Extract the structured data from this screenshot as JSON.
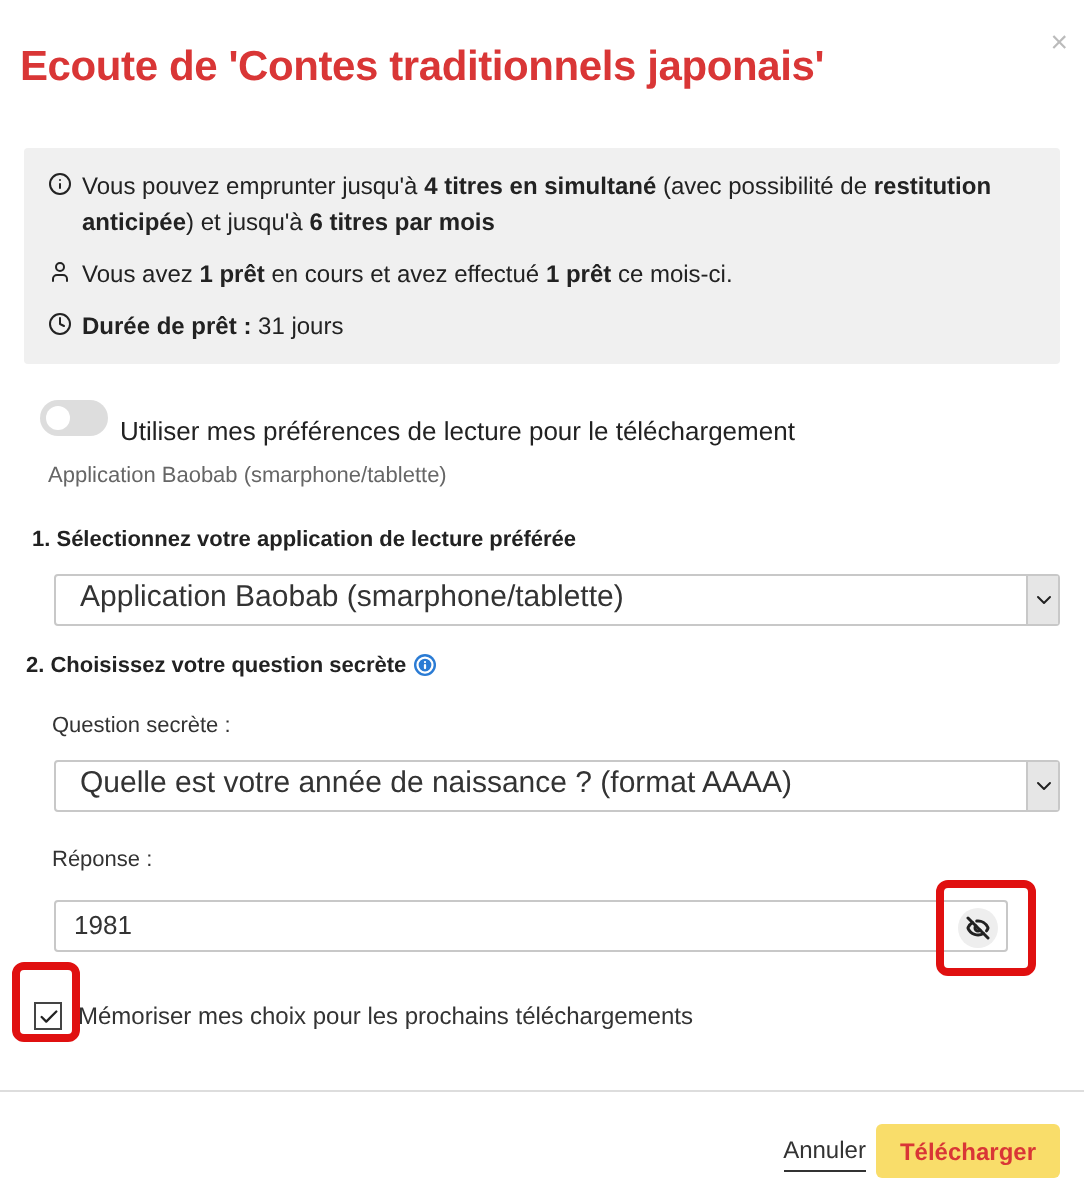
{
  "dialog": {
    "title": "Ecoute de 'Contes traditionnels japonais'",
    "close": "×"
  },
  "info": [
    {
      "kind": "info",
      "text": "Vous pouvez emprunter jusqu'à **4 titres en simultané** (avec possibilité de **restitution anticipée**) et jusqu'à **6 titres par mois**"
    },
    {
      "kind": "user",
      "text": "Vous avez **1 prêt** en cours et avez effectué **1 prêt** ce mois-ci."
    },
    {
      "kind": "clock",
      "text": "**Durée de prêt :** 31 jours"
    }
  ],
  "preferences_toggle": {
    "label": "Utiliser mes préférences de lecture pour le téléchargement",
    "on": false,
    "hint": "Application Baobab (smarphone/tablette)"
  },
  "step_1": {
    "heading": "1. Sélectionnez votre application de lecture préférée",
    "select_value": "Application Baobab (smarphone/tablette)"
  },
  "step_2": {
    "heading": "2. Choisissez votre question secrète",
    "question_label": "Question secrète :",
    "question_value": "Quelle est votre année de naissance ? (format AAAA)",
    "answer_label": "Réponse :",
    "answer_value": "1981",
    "reveal_highlighted": true
  },
  "remember_checkbox": {
    "label": "Mémoriser mes choix pour les prochains téléchargements",
    "checked": true,
    "highlighted": true
  },
  "buttons": {
    "cancel": "Annuler",
    "download": "Télécharger"
  }
}
